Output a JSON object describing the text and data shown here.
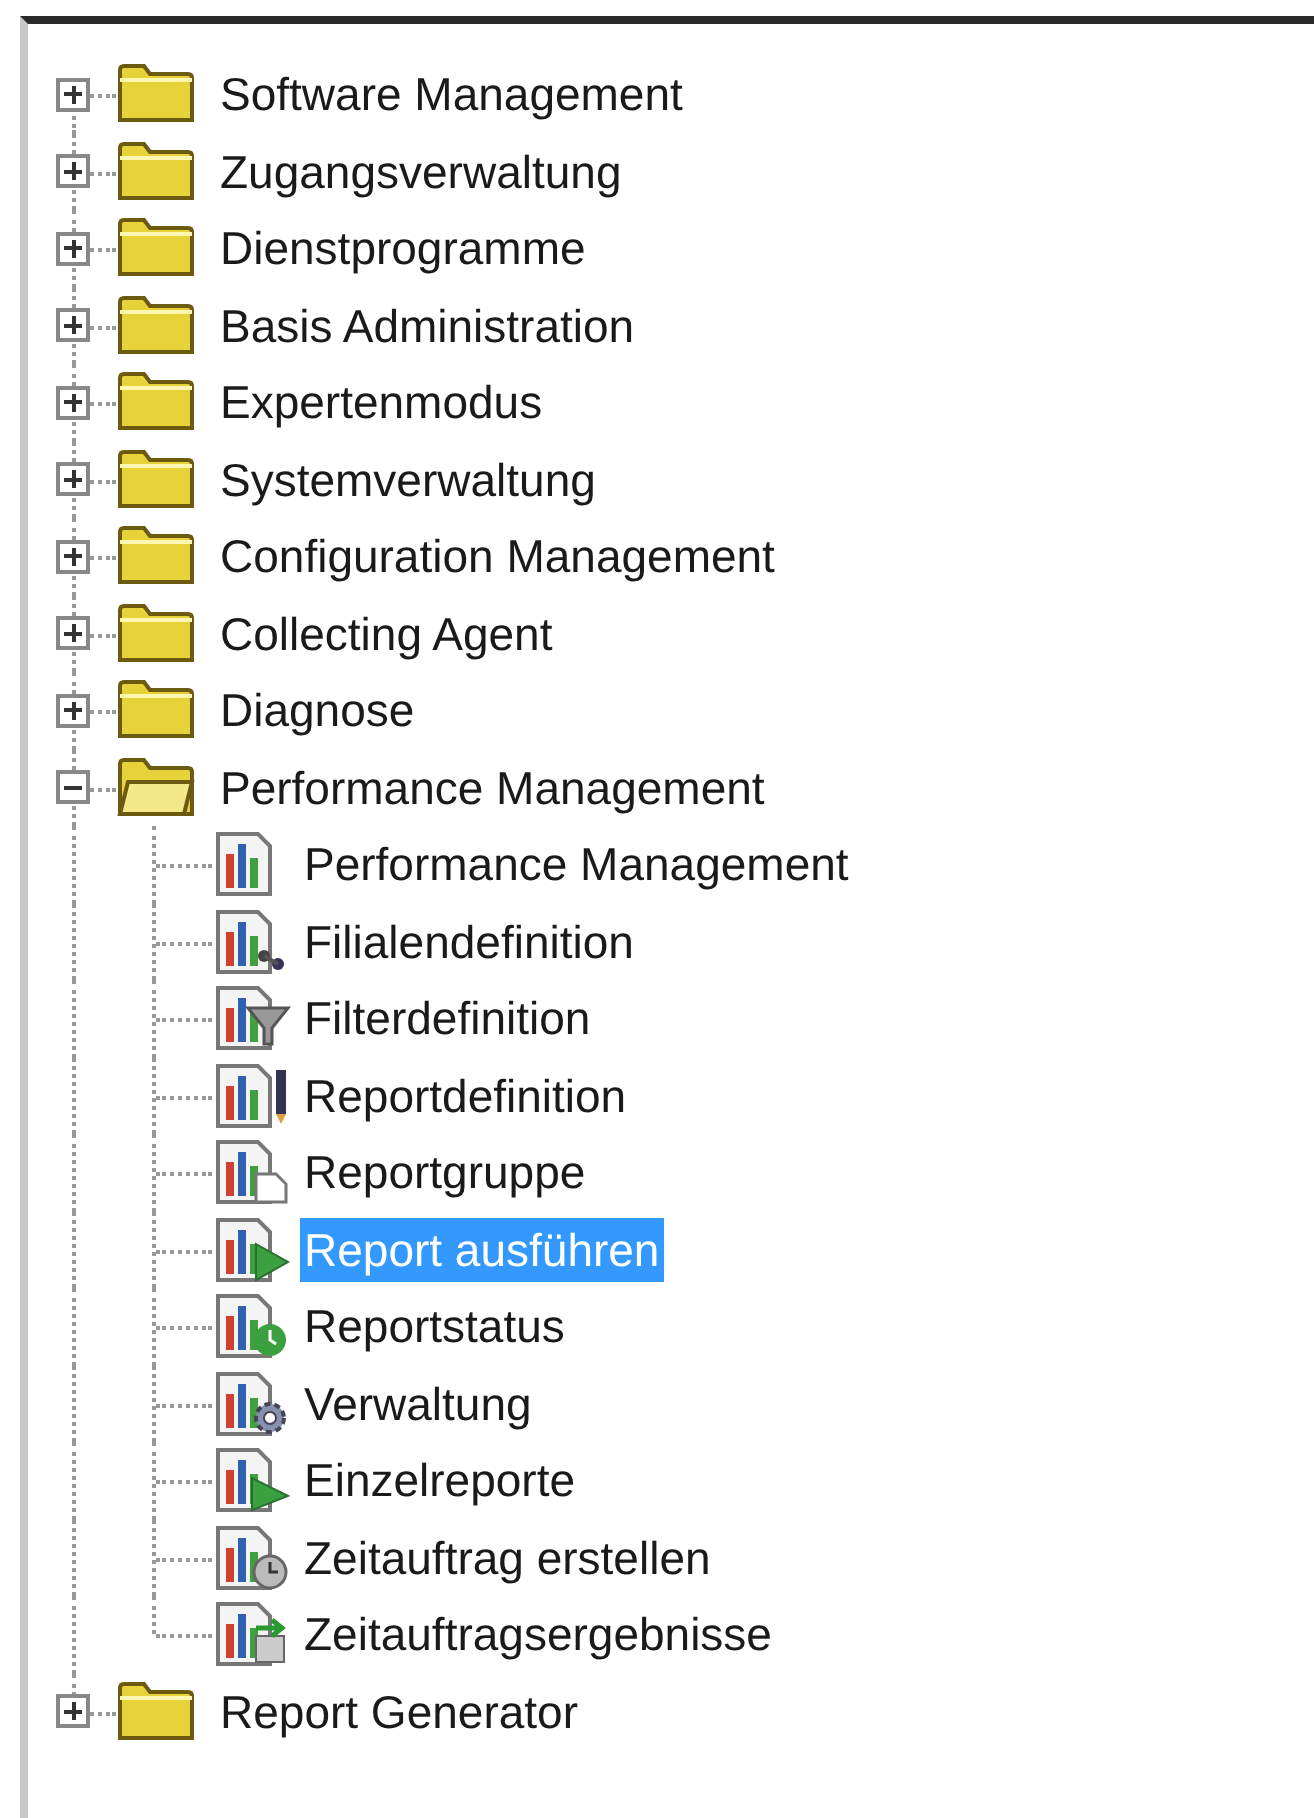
{
  "tree": [
    {
      "label": "Software Management",
      "expanded": false,
      "selected": false
    },
    {
      "label": "Zugangsverwaltung",
      "expanded": false,
      "selected": false
    },
    {
      "label": "Dienstprogramme",
      "expanded": false,
      "selected": false
    },
    {
      "label": "Basis Administration",
      "expanded": false,
      "selected": false
    },
    {
      "label": "Expertenmodus",
      "expanded": false,
      "selected": false
    },
    {
      "label": "Systemverwaltung",
      "expanded": false,
      "selected": false
    },
    {
      "label": "Configuration Management",
      "expanded": false,
      "selected": false
    },
    {
      "label": "Collecting Agent",
      "expanded": false,
      "selected": false
    },
    {
      "label": "Diagnose",
      "expanded": false,
      "selected": false
    },
    {
      "label": "Performance Management",
      "expanded": true,
      "selected": false,
      "children": [
        {
          "label": "Performance Management",
          "kind": "chart",
          "selected": false
        },
        {
          "label": "Filialendefinition",
          "kind": "branch",
          "selected": false
        },
        {
          "label": "Filterdefinition",
          "kind": "filter",
          "selected": false
        },
        {
          "label": "Reportdefinition",
          "kind": "edit",
          "selected": false
        },
        {
          "label": "Reportgruppe",
          "kind": "group",
          "selected": false
        },
        {
          "label": "Report ausführen",
          "kind": "run",
          "selected": true
        },
        {
          "label": "Reportstatus",
          "kind": "status",
          "selected": false
        },
        {
          "label": "Verwaltung",
          "kind": "settings",
          "selected": false
        },
        {
          "label": "Einzelreporte",
          "kind": "single",
          "selected": false
        },
        {
          "label": "Zeitauftrag erstellen",
          "kind": "schedule",
          "selected": false
        },
        {
          "label": "Zeitauftragsergebnisse",
          "kind": "results",
          "selected": false
        }
      ]
    },
    {
      "label": "Report Generator",
      "expanded": false,
      "selected": false
    }
  ]
}
